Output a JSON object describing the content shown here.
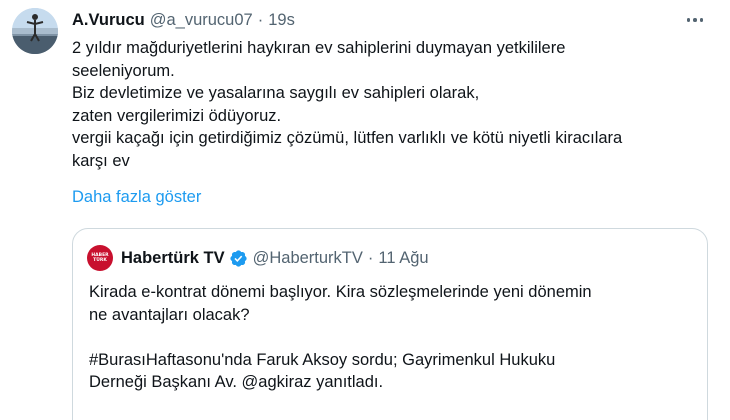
{
  "tweet": {
    "author_name": "A.Vurucu",
    "author_handle": "@a_vurucu07",
    "separator": "·",
    "time": "19s",
    "lines": [
      "2 yıldır mağduriyetlerini haykıran ev sahiplerini duymayan yetkililere",
      "seeleniyorum.",
      "Biz devletimize ve yasalarına saygılı ev sahipleri olarak,",
      "zaten vergilerimizi ödüyoruz.",
      "vergii kaçağı için getirdiğimiz çözümü, lütfen varlıklı ve kötü niyetli kiracılara",
      "karşı ev"
    ],
    "show_more": "Daha fazla göster",
    "more_icon": "more-dots-icon"
  },
  "quote": {
    "avatar_text": [
      "HABER",
      "TÜRK"
    ],
    "author_name": "Habertürk TV",
    "verified_icon": "verified-badge-icon",
    "verified_color": "#1d9bf0",
    "author_handle": "@HaberturkTV",
    "separator": "·",
    "time": "11 Ağu",
    "lines": [
      "Kirada e-kontrat dönemi başlıyor. Kira sözleşmelerinde yeni dönemin",
      "ne avantajları olacak?",
      "",
      "#BurasıHaftasonu'nda Faruk Aksoy sordu; Gayrimenkul Hukuku",
      "Derneği Başkanı Av. @agkiraz yanıtladı."
    ]
  },
  "colors": {
    "text_primary": "#0f1419",
    "text_secondary": "#536471",
    "link": "#1d9bf0",
    "border": "#cfd9de",
    "brand_red": "#c8102e"
  }
}
